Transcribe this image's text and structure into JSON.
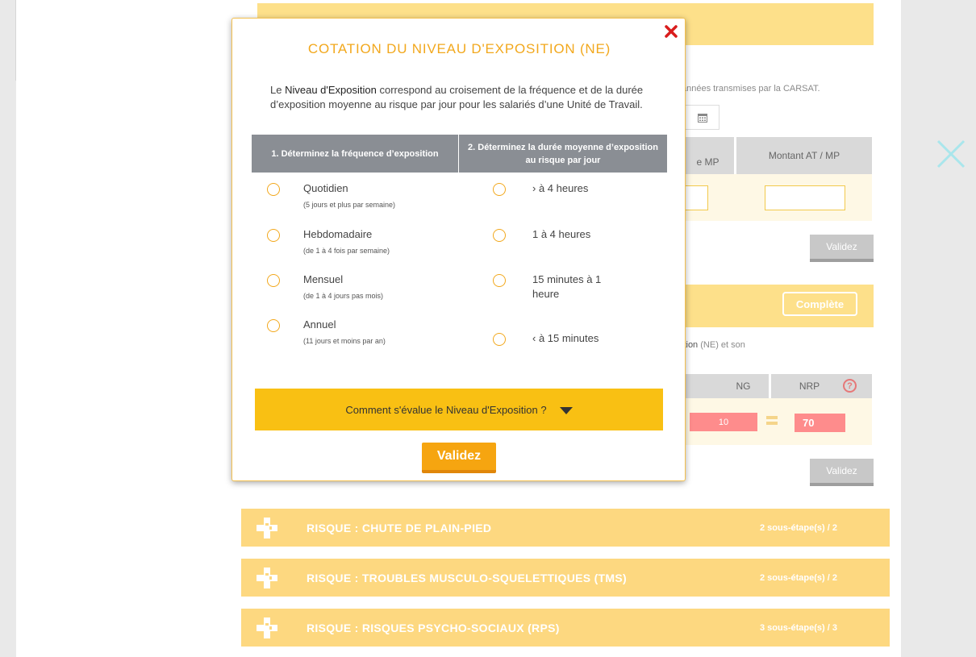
{
  "background": {
    "carsat_note": "années transmises par la CARSAT.",
    "col_mp": "e MP",
    "col_montant": "Montant AT / MP",
    "validate_label": "Validez",
    "complete_label": "Complète",
    "ne_text_bold": "ition",
    "ne_text_rest": " (NE) et son",
    "col_ng": "NG",
    "col_nrp": "NRP",
    "ng_value": "10",
    "nrp_value": "70",
    "help_glyph": "?"
  },
  "risks": [
    {
      "title": "RISQUE : CHUTE DE PLAIN-PIED",
      "count": "2 sous-étape(s) / 2"
    },
    {
      "title": "RISQUE : TROUBLES MUSCULO-SQUELETTIQUES (TMS)",
      "count": "2 sous-étape(s) / 2"
    },
    {
      "title": "RISQUE : RISQUES PSYCHO-SOCIAUX (RPS)",
      "count": "3 sous-étape(s) / 3"
    }
  ],
  "modal": {
    "title": "COTATION DU NIVEAU D'EXPOSITION (NE)",
    "intro_prefix": "Le ",
    "intro_bold": "Niveau d'Exposition",
    "intro_rest": " correspond au croisement de la fréquence et de la durée d’exposition moyenne  au risque par jour pour les salariés d’une Unité de Travail.",
    "col1_header": "1. Déterminez la fréquence d’exposition",
    "col2_header": "2. Déterminez la durée moyenne d’exposition au risque par jour",
    "frequency_options": [
      {
        "label": "Quotidien",
        "sub": "(5 jours et plus par semaine)"
      },
      {
        "label": "Hebdomadaire",
        "sub": "(de 1 à 4 fois par semaine)"
      },
      {
        "label": "Mensuel",
        "sub": "(de 1 à 4 jours pas mois)"
      },
      {
        "label": "Annuel",
        "sub": "(11 jours et moins par an)"
      }
    ],
    "duration_options": [
      {
        "label": "› à 4 heures"
      },
      {
        "label": "1 à 4 heures"
      },
      {
        "label": "15 minutes à 1 heure"
      },
      {
        "label": "‹ à 15 minutes"
      }
    ],
    "expo_question": "Comment s'évalue le Niveau d'Exposition ?",
    "validate_label": "Validez",
    "colors": {
      "accent": "#f2a81d",
      "bar": "#f9c013",
      "header": "#8a8e94"
    }
  }
}
